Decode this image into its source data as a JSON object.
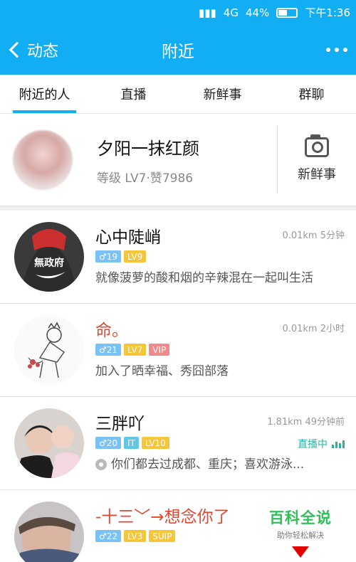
{
  "status_bar": {
    "network": "4G",
    "battery": "44%",
    "time": "下午1:36"
  },
  "nav": {
    "back_label": "动态",
    "title": "附近"
  },
  "tabs": [
    {
      "label": "附近的人",
      "active": true
    },
    {
      "label": "直播",
      "active": false
    },
    {
      "label": "新鲜事",
      "active": false
    },
    {
      "label": "群聊",
      "active": false
    }
  ],
  "me": {
    "name": "夕阳一抹红颜",
    "level_text": "等级 LV7·赞7986",
    "news_label": "新鲜事"
  },
  "people": [
    {
      "name": "心中陡峭",
      "distance_time": "0.01km 5分钟",
      "badges": [
        "♂19",
        "LV9"
      ],
      "signature": "就像菠萝的酸和烟的辛辣混在一起叫生活"
    },
    {
      "name": "命。",
      "distance_time": "0.01km 2小时",
      "badges": [
        "♂21",
        "LV7",
        "VIP"
      ],
      "signature": "加入了晒幸福、秀囧部落"
    },
    {
      "name": "三胖吖",
      "distance_time": "1.81km 49分钟前",
      "badges": [
        "♂20",
        "IT",
        "LV10"
      ],
      "live": "直播中",
      "signature": "你们都去过成都、重庆；喜欢游泳..."
    },
    {
      "name": "-十三﹀→想念你了",
      "distance_time": "",
      "badges": [
        "♂22",
        "LV3",
        "SUIP"
      ],
      "signature": ""
    }
  ],
  "watermark": {
    "title": "百科全说",
    "subtitle": "助你轻松解决"
  },
  "colors": {
    "accent": "#12aef3",
    "name_red": "#e5452f",
    "live_green": "#2bb39f"
  }
}
